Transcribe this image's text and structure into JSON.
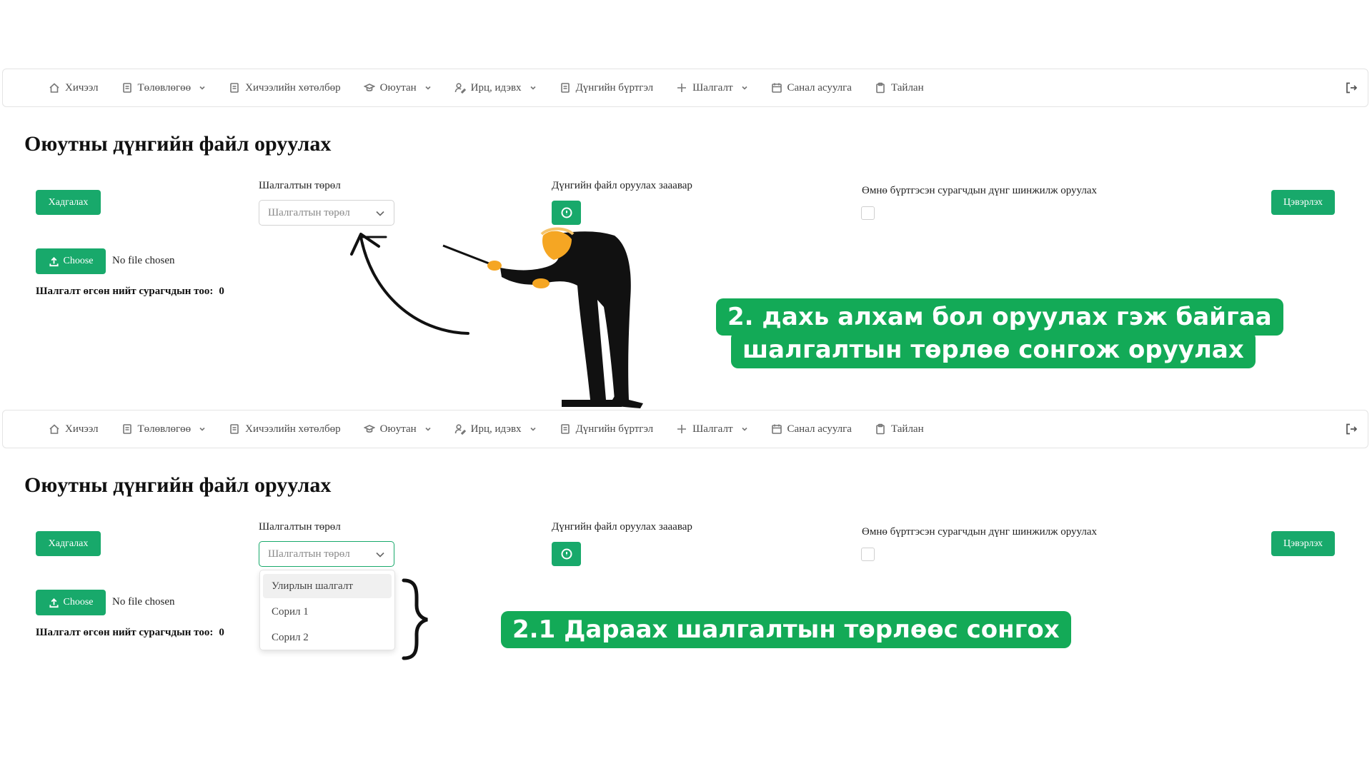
{
  "nav": {
    "items": [
      {
        "label": "Хичээл",
        "icon": "home-icon",
        "dropdown": false
      },
      {
        "label": "Төлөвлөгөө",
        "icon": "document-icon",
        "dropdown": true
      },
      {
        "label": "Хичээлийн хөтөлбөр",
        "icon": "document-icon",
        "dropdown": false
      },
      {
        "label": "Оюутан",
        "icon": "graduation-cap-icon",
        "dropdown": true
      },
      {
        "label": "Ирц, идэвх",
        "icon": "user-edit-icon",
        "dropdown": true
      },
      {
        "label": "Дүнгийн бүртгэл",
        "icon": "document-icon",
        "dropdown": false
      },
      {
        "label": "Шалгалт",
        "icon": "plus-icon",
        "dropdown": true
      },
      {
        "label": "Санал асуулга",
        "icon": "calendar-icon",
        "dropdown": false
      },
      {
        "label": "Тайлан",
        "icon": "clipboard-icon",
        "dropdown": false
      }
    ],
    "logout_icon": "logout-icon"
  },
  "page": {
    "title": "Оюутны дүнгийн файл оруулах",
    "save_label": "Хадгалах",
    "clear_label": "Цэвэрлэх",
    "choose_label": "Choose",
    "no_file_text": "No file chosen",
    "exam_type_label": "Шалгалтын төрөл",
    "exam_type_placeholder": "Шалгалтын төрөл",
    "guide_label": "Дүнгийн файл оруулах зааавар",
    "prev_label": "Өмнө бүртгэсэн сурагчдын дүнг шинжилж оруулах",
    "count_label": "Шалгалт өгсөн нийт сурагчдын тоо:",
    "count_value": "0"
  },
  "dropdown": {
    "options": [
      "Улирлын шалгалт",
      "Сорил 1",
      "Сорил 2"
    ],
    "highlighted_index": 0
  },
  "callouts": {
    "step2_line1": "2. дахь алхам бол оруулах гэж байгаа",
    "step2_line2": "шалгалтын төрлөө сонгож оруулах",
    "step2_1": "2.1 Дараах шалгалтын төрлөөс сонгох"
  },
  "colors": {
    "accent": "#18a96b",
    "callout": "#13aa57"
  }
}
